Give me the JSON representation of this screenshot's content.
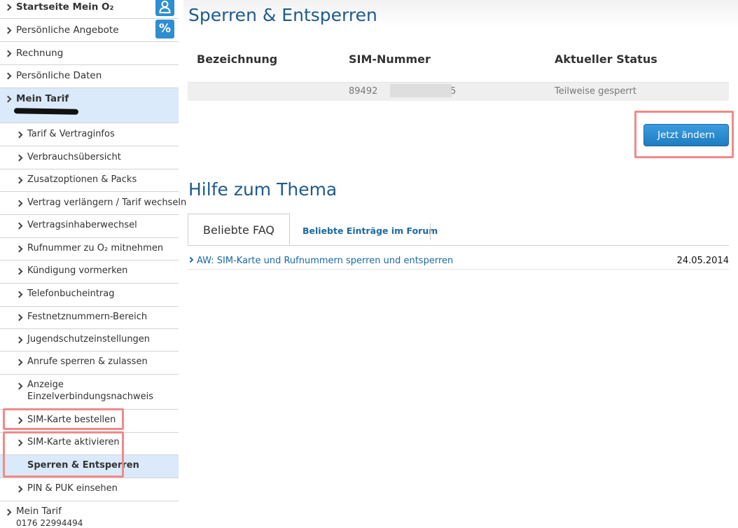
{
  "sidebar": {
    "top_items": [
      {
        "label": "Startseite Mein O₂"
      },
      {
        "label": "Persönliche Angebote"
      },
      {
        "label": "Rechnung"
      },
      {
        "label": "Persönliche Daten"
      },
      {
        "label": "Mein Tarif"
      }
    ],
    "sub_items": [
      {
        "label": "Tarif & Vertraginfos"
      },
      {
        "label": "Verbrauchsübersicht"
      },
      {
        "label": "Zusatzoptionen & Packs"
      },
      {
        "label": "Vertrag verlängern / Tarif wechseln"
      },
      {
        "label": "Vertragsinhaberwechsel"
      },
      {
        "label": "Rufnummer zu O₂ mitnehmen"
      },
      {
        "label": "Kündigung vormerken"
      },
      {
        "label": "Telefonbucheintrag"
      },
      {
        "label": "Festnetznummern-Bereich"
      },
      {
        "label": "Jugendschutzeinstellungen"
      },
      {
        "label": "Anrufe sperren & zulassen"
      },
      {
        "label": "Anzeige"
      },
      {
        "label": "SIM-Karte bestellen"
      },
      {
        "label": "SIM-Karte aktivieren"
      },
      {
        "label": "Sperren & Entsperren"
      },
      {
        "label": "PIN & PUK einsehen"
      }
    ],
    "sub_item_11_line2": "Einzelverbindungsnachweis",
    "bottom_item": {
      "label": "Mein Tarif",
      "number": "0176 22994494"
    },
    "badges": {
      "user": "user-icon",
      "percent": "%"
    }
  },
  "main": {
    "title": "Sperren & Entsperren",
    "table": {
      "headers": [
        "Bezeichnung",
        "SIM-Nummer",
        "Aktueller Status"
      ],
      "rows": [
        {
          "bezeichnung": "",
          "sim_prefix": "89492",
          "sim_suffix": "5",
          "status": "Teilweise gesperrt"
        }
      ]
    },
    "action_button": "Jetzt ändern",
    "help_title": "Hilfe zum Thema",
    "tabs": [
      "Beliebte FAQ",
      "Beliebte Einträge im Forum"
    ],
    "faq_items": [
      {
        "title": "AW: SIM-Karte und Rufnummern sperren und entsperren",
        "date": "24.05.2014"
      }
    ]
  },
  "colors": {
    "brand_blue": "#1f5b8d",
    "button_blue": "#2a8ad4",
    "active_bg": "#dbeafa",
    "highlight_red": "#f08a8a"
  }
}
